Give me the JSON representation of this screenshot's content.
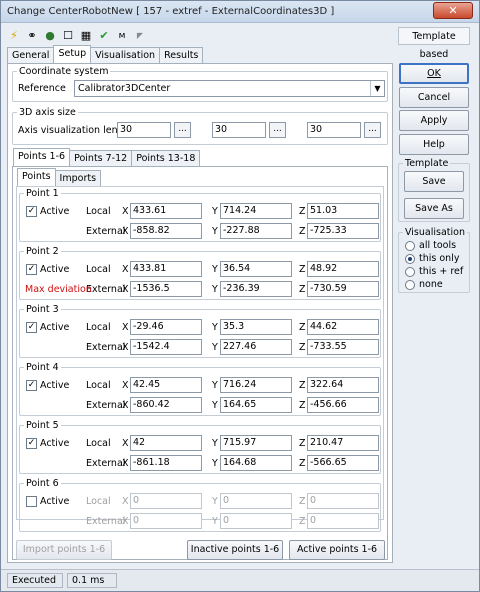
{
  "window": {
    "title": "Change CenterRobotNew [ 157 - extref - ExternalCoordinates3D ]",
    "close_glyph": "✕"
  },
  "toolbar": {
    "template_label": "Template based"
  },
  "tabs": [
    "General",
    "Setup",
    "Visualisation",
    "Results"
  ],
  "coordinate_system": {
    "legend": "Coordinate system",
    "reference_label": "Reference",
    "reference_value": "Calibrator3DCenter"
  },
  "axis_size": {
    "legend": "3D axis size",
    "label": "Axis visualization length",
    "values": [
      "30",
      "30",
      "30"
    ],
    "dots": "..."
  },
  "point_tabs": [
    "Points 1-6",
    "Points 7-12",
    "Points 13-18"
  ],
  "sub_tabs": [
    "Points",
    "Imports"
  ],
  "labels": {
    "active": "Active",
    "local": "Local",
    "external": "External",
    "x": "X",
    "y": "Y",
    "z": "Z"
  },
  "points": [
    {
      "name": "Point 1",
      "active": true,
      "extra": "",
      "local": [
        "433.61",
        "714.24",
        "51.03"
      ],
      "external": [
        "-858.82",
        "-227.88",
        "-725.33"
      ]
    },
    {
      "name": "Point 2",
      "active": true,
      "extra": "Max deviation",
      "local": [
        "433.81",
        "36.54",
        "48.92"
      ],
      "external": [
        "-1536.5",
        "-236.39",
        "-730.59"
      ]
    },
    {
      "name": "Point 3",
      "active": true,
      "extra": "",
      "local": [
        "-29.46",
        "35.3",
        "44.62"
      ],
      "external": [
        "-1542.4",
        "227.46",
        "-733.55"
      ]
    },
    {
      "name": "Point 4",
      "active": true,
      "extra": "",
      "local": [
        "42.45",
        "716.24",
        "322.64"
      ],
      "external": [
        "-860.42",
        "164.65",
        "-456.66"
      ]
    },
    {
      "name": "Point 5",
      "active": true,
      "extra": "",
      "local": [
        "42",
        "715.97",
        "210.47"
      ],
      "external": [
        "-861.18",
        "164.68",
        "-566.65"
      ]
    },
    {
      "name": "Point 6",
      "active": false,
      "extra": "",
      "local": [
        "0",
        "0",
        "0"
      ],
      "external": [
        "0",
        "0",
        "0"
      ]
    }
  ],
  "bottom_buttons": {
    "import": "Import points 1-6",
    "inactive": "Inactive points 1-6",
    "active": "Active points 1-6"
  },
  "right_panel": {
    "ok": "OK",
    "cancel": "Cancel",
    "apply": "Apply",
    "help": "Help",
    "template_legend": "Template",
    "save": "Save",
    "save_as": "Save As",
    "visualisation_legend": "Visualisation",
    "vis_options": [
      "all tools",
      "this only",
      "this + ref",
      "none"
    ],
    "vis_selected": "this only"
  },
  "status": {
    "state": "Executed",
    "time": "0.1 ms"
  },
  "colors": {
    "max_deviation": "#d01010",
    "default_button_border": "#3d72c5"
  }
}
